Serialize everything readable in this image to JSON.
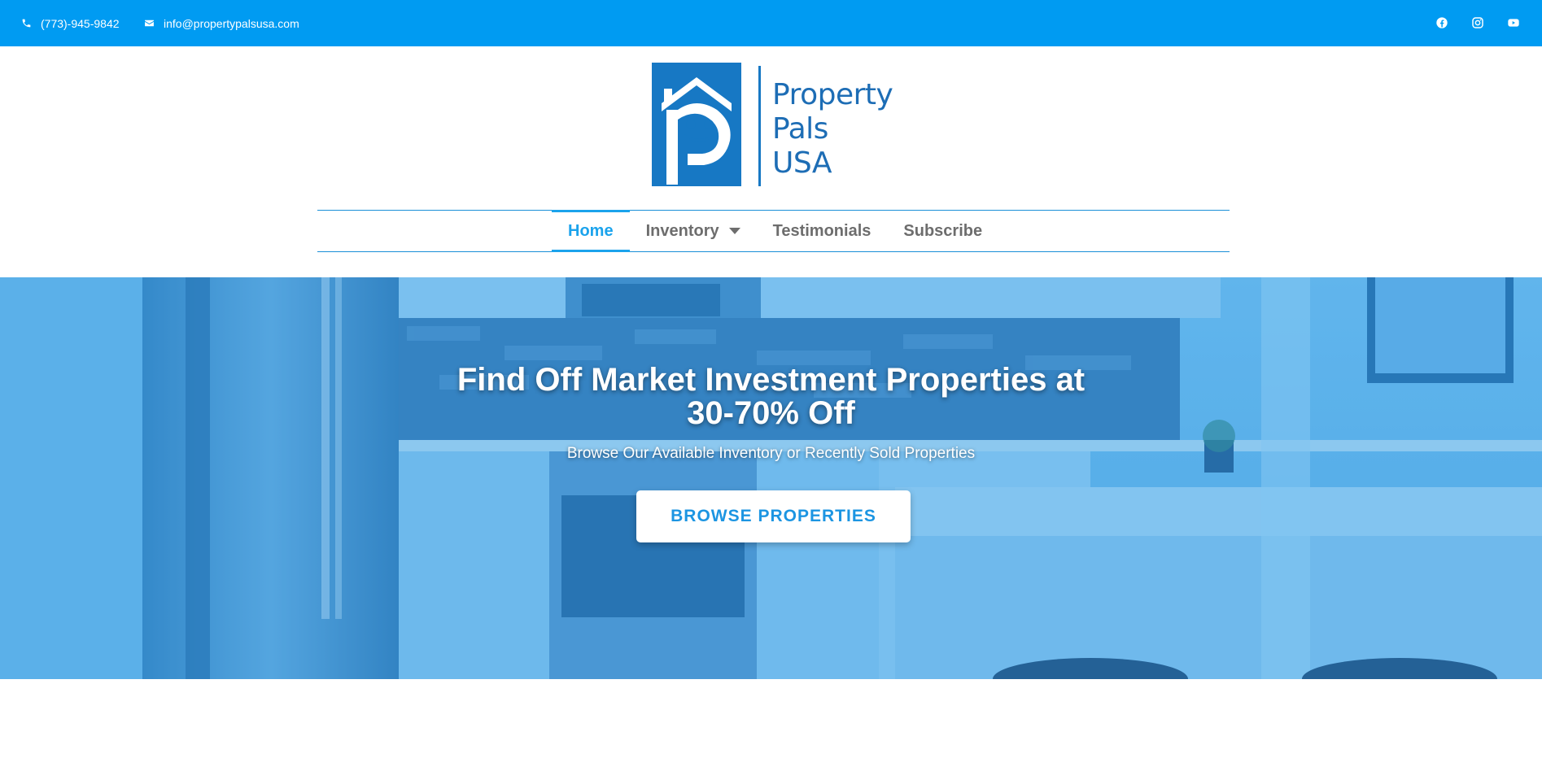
{
  "topbar": {
    "phone": "(773)-945-9842",
    "email": "info@propertypalsusa.com",
    "social": [
      "facebook-icon",
      "instagram-icon",
      "youtube-icon"
    ]
  },
  "brand": {
    "line1": "Property",
    "line2": "Pals",
    "line3": "USA",
    "color": "#1d6db5"
  },
  "nav": {
    "items": [
      {
        "label": "Home",
        "active": true
      },
      {
        "label": "Inventory",
        "has_dropdown": true
      },
      {
        "label": "Testimonials"
      },
      {
        "label": "Subscribe"
      }
    ]
  },
  "hero": {
    "title_line1": "Find Off Market Investment Properties at",
    "title_line2": "30-70% Off",
    "subtitle": "Browse Our Available Inventory or Recently Sold Properties",
    "cta_label": "BROWSE PROPERTIES"
  },
  "colors": {
    "topbar": "#009bf2",
    "accent": "#1ba3ec",
    "nav_text": "#6d6d6d"
  }
}
